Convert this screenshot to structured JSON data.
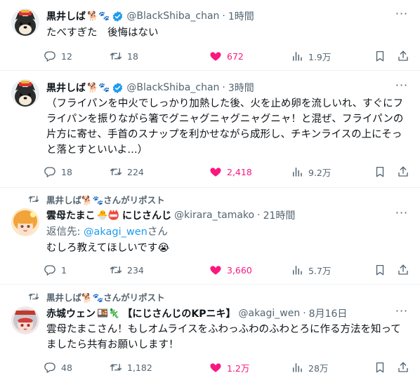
{
  "tweets": [
    {
      "name": "黒井しば",
      "name_emoji": "🐕🐾",
      "handle": "@BlackShiba_chan",
      "time": "1時間",
      "text": "たべすぎた　後悔はない",
      "replies": "12",
      "reposts": "18",
      "likes": "672",
      "views": "1.9万"
    },
    {
      "name": "黒井しば",
      "name_emoji": "🐕🐾",
      "handle": "@BlackShiba_chan",
      "time": "3時間",
      "text": "（フライパンを中火でしっかり加熱した後、火を止め卵を流しいれ、すぐにフライパンを振りながら箸でグニャグニャグニャグニャ！と混ぜ、フライパンの片方に寄せ、手首のスナップを利かせながら成形し、チキンライスの上にそっと落とすといいよ…）",
      "replies": "18",
      "reposts": "224",
      "likes": "2,418",
      "views": "9.2万"
    },
    {
      "repost_label": "黒井しば🐕🐾さんがリポスト",
      "name": "雲母たまこ",
      "name_emoji": "🐣📛",
      "org": "にじさんじ",
      "handle": "@kirara_tamako",
      "time": "21時間",
      "reply_prefix": "返信先: ",
      "reply_target": "@akagi_wen",
      "reply_suffix": "さん",
      "text": "むしろ教えてほしいです😭",
      "replies": "1",
      "reposts": "234",
      "likes": "3,660",
      "views": "5.7万"
    },
    {
      "repost_label": "黒井しば🐕🐾さんがリポスト",
      "name": "赤城ウェン",
      "name_emoji": "🍱🦎",
      "org": "【にじさんじのKPニキ】",
      "handle": "@akagi_wen",
      "time": "8月16日",
      "text": "雲母たまこさん！もしオムライスをふわっふわのふわとろに作る方法を知ってましたら共有お願いします！",
      "replies": "48",
      "reposts": "1,182",
      "likes": "1.2万",
      "views": "28万"
    }
  ],
  "icons": {
    "more": "more-icon",
    "reply": "reply-icon",
    "repost": "repost-icon",
    "like": "heart-icon",
    "views": "views-icon",
    "bookmark": "bookmark-icon",
    "share": "share-icon",
    "verified": "verified-badge-icon"
  },
  "colors": {
    "accent": "#1d9bf0",
    "like": "#f91880",
    "secondary_text": "#536471",
    "divider": "#eff3f4"
  }
}
